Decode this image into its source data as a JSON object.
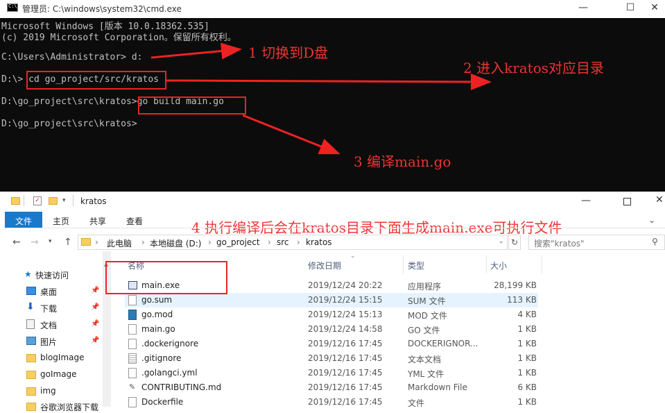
{
  "cmd": {
    "title": "管理员: C:\\windows\\system32\\cmd.exe",
    "lines": [
      "Microsoft Windows [版本 10.0.18362.535]",
      "(c) 2019 Microsoft Corporation。保留所有权利。",
      "C:\\Users\\Administrator> d:",
      "D:\\> cd go_project/src/kratos",
      "D:\\go_project\\src\\kratos>go build main.go",
      "D:\\go_project\\src\\kratos>"
    ],
    "window_buttons": [
      "—",
      "☐",
      "✕"
    ]
  },
  "annotations": {
    "step1": "1 切换到D盘",
    "step2": "2 进入kratos对应目录",
    "step3": "3 编译main.go",
    "step4": "4 执行编译后会在kratos目录下面生成main.exe可执行文件",
    "color": "#e33333"
  },
  "explorer": {
    "title": "kratos",
    "ribbon_tabs": [
      "文件",
      "主页",
      "共享",
      "查看"
    ],
    "breadcrumb": [
      "此电脑",
      "本地磁盘 (D:)",
      "go_project",
      "src",
      "kratos"
    ],
    "search_placeholder": "搜索\"kratos\"",
    "sidebar": [
      {
        "label": "快速访问",
        "icon": "star-icon"
      },
      {
        "label": "桌面",
        "icon": "desktop-icon",
        "pinned": true
      },
      {
        "label": "下载",
        "icon": "download-icon",
        "pinned": true
      },
      {
        "label": "文档",
        "icon": "document-icon",
        "pinned": true
      },
      {
        "label": "图片",
        "icon": "picture-icon",
        "pinned": true
      },
      {
        "label": "blogImage",
        "icon": "folder-icon"
      },
      {
        "label": "goImage",
        "icon": "folder-icon"
      },
      {
        "label": "img",
        "icon": "folder-icon"
      },
      {
        "label": "谷歌浏览器下载",
        "icon": "folder-icon"
      }
    ],
    "columns": {
      "name": "名称",
      "date": "修改日期",
      "type": "类型",
      "size": "大小"
    },
    "files": [
      {
        "name": "main.exe",
        "date": "2019/12/24 20:22",
        "type": "应用程序",
        "size": "28,199 KB",
        "icon": "exe-icon"
      },
      {
        "name": "go.sum",
        "date": "2019/12/24 15:15",
        "type": "SUM 文件",
        "size": "113 KB",
        "icon": "file-icon"
      },
      {
        "name": "go.mod",
        "date": "2019/12/24 15:13",
        "type": "MOD 文件",
        "size": "4 KB",
        "icon": "go-file-icon"
      },
      {
        "name": "main.go",
        "date": "2019/12/24 14:58",
        "type": "GO 文件",
        "size": "1 KB",
        "icon": "file-icon"
      },
      {
        "name": ".dockerignore",
        "date": "2019/12/16 17:45",
        "type": "DOCKERIGNOR...",
        "size": "1 KB",
        "icon": "file-icon"
      },
      {
        "name": ".gitignore",
        "date": "2019/12/16 17:45",
        "type": "文本文档",
        "size": "1 KB",
        "icon": "text-file-icon"
      },
      {
        "name": ".golangci.yml",
        "date": "2019/12/16 17:45",
        "type": "YML 文件",
        "size": "1 KB",
        "icon": "file-icon"
      },
      {
        "name": "CONTRIBUTING.md",
        "date": "2019/12/16 17:45",
        "type": "Markdown File",
        "size": "6 KB",
        "icon": "markdown-icon"
      },
      {
        "name": "Dockerfile",
        "date": "2019/12/16 17:45",
        "type": "文件",
        "size": "1 KB",
        "icon": "file-icon"
      }
    ]
  }
}
